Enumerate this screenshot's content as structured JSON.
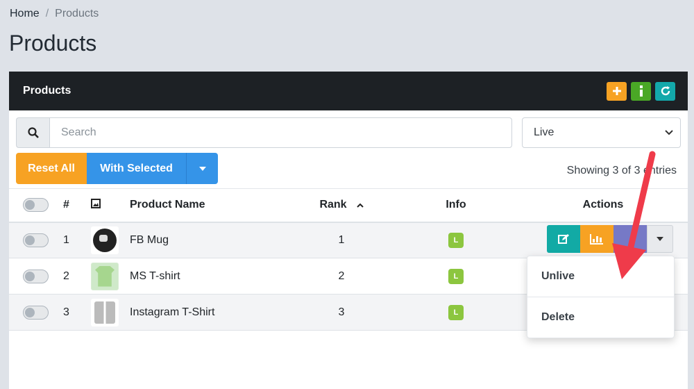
{
  "breadcrumb": {
    "home": "Home",
    "separator": "/",
    "current": "Products"
  },
  "page_title": "Products",
  "card": {
    "title": "Products",
    "header_buttons": [
      {
        "icon": "plus-icon",
        "color": "#f7a223"
      },
      {
        "icon": "info-icon",
        "color": "#4aa826"
      },
      {
        "icon": "refresh-icon",
        "color": "#13a8aa"
      }
    ]
  },
  "search": {
    "placeholder": "Search",
    "value": ""
  },
  "status_filter": {
    "selected": "Live"
  },
  "toolbar": {
    "reset_label": "Reset All",
    "with_selected_label": "With Selected"
  },
  "showing_text": "Showing 3 of 3 entries",
  "table": {
    "headers": {
      "number": "#",
      "name": "Product Name",
      "rank": "Rank",
      "info": "Info",
      "actions": "Actions"
    },
    "rows": [
      {
        "number": "1",
        "name": "FB Mug",
        "rank": "1",
        "badge": "L"
      },
      {
        "number": "2",
        "name": "MS T-shirt",
        "rank": "2",
        "badge": "L"
      },
      {
        "number": "3",
        "name": "Instagram T-Shirt",
        "rank": "3",
        "badge": "L"
      }
    ]
  },
  "dropdown": {
    "items": [
      "Unlive",
      "Delete"
    ]
  },
  "colors": {
    "accent_orange": "#f7a223",
    "accent_blue": "#3594e8",
    "badge_green": "#8cc63f",
    "arrow_red": "#ef3b4a"
  }
}
